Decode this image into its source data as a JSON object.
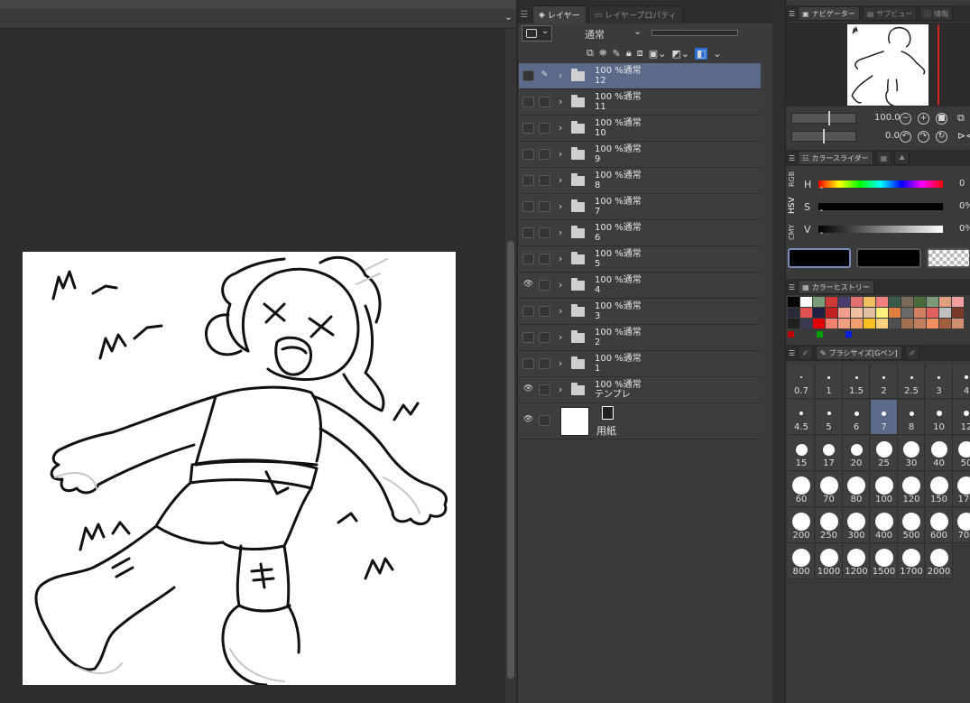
{
  "layer_panel": {
    "tabs": [
      {
        "label": "レイヤー",
        "active": true
      },
      {
        "label": "レイヤープロパティ",
        "active": false
      }
    ],
    "blend_mode": "通常",
    "layers": [
      {
        "opacity_mode": "100 %通常",
        "name": "12",
        "visible": false,
        "selected": true,
        "pen": true
      },
      {
        "opacity_mode": "100 %通常",
        "name": "11",
        "visible": false
      },
      {
        "opacity_mode": "100 %通常",
        "name": "10",
        "visible": false
      },
      {
        "opacity_mode": "100 %通常",
        "name": "9",
        "visible": false
      },
      {
        "opacity_mode": "100 %通常",
        "name": "8",
        "visible": false
      },
      {
        "opacity_mode": "100 %通常",
        "name": "7",
        "visible": false
      },
      {
        "opacity_mode": "100 %通常",
        "name": "6",
        "visible": false
      },
      {
        "opacity_mode": "100 %通常",
        "name": "5",
        "visible": false
      },
      {
        "opacity_mode": "100 %通常",
        "name": "4",
        "visible": true
      },
      {
        "opacity_mode": "100 %通常",
        "name": "3",
        "visible": false
      },
      {
        "opacity_mode": "100 %通常",
        "name": "2",
        "visible": false
      },
      {
        "opacity_mode": "100 %通常",
        "name": "1",
        "visible": false
      },
      {
        "opacity_mode": "100 %通常",
        "name": "テンプレ",
        "visible": true
      }
    ],
    "paper_layer": {
      "name": "用紙",
      "visible": true
    }
  },
  "navigator": {
    "tabs": [
      "ナビゲーター",
      "サブビュー",
      "情報"
    ],
    "zoom_value": "100.0",
    "rotate_value": "0.0"
  },
  "color_slider": {
    "tabs": [
      "カラースライダー"
    ],
    "modes": [
      "RGB",
      "HSV",
      "CMY"
    ],
    "h_label": "H",
    "h_value": "0",
    "s_label": "S",
    "s_value": "0%",
    "v_label": "V",
    "v_value": "0%"
  },
  "color_history": {
    "title": "カラーヒストリー",
    "row1": [
      "#000000",
      "#ffffff",
      "#7a9a7a",
      "#d23a3a",
      "#4a3c6e",
      "#e07070",
      "#f0c060",
      "#f08080",
      "#3a5a4a",
      "#7a6a5a",
      "#4a6a3a",
      "#7a9a7a",
      "#e0a080",
      "#f0a0a0"
    ],
    "row2": [
      "#2a2a3a",
      "#e05050",
      "#202040",
      "#c02020",
      "#f0a090",
      "#f0c0a0",
      "#e0c0a0",
      "#fff080",
      "#e08040",
      "#6a6a6a",
      "#d08060",
      "#e06060",
      "#c0c0c0",
      "#7a3a2a"
    ],
    "row3": [
      "#202020",
      "#3a3a50",
      "#e00000",
      "#f08070",
      "#f0a080",
      "#f0a070",
      "#ffc020",
      "#ffd080",
      "#505050",
      "#a07050",
      "#c08060",
      "#f09060",
      "#a06040",
      "#d09070"
    ],
    "indicators": [
      "#c00000",
      "#00a000",
      "#0020e0"
    ]
  },
  "brush_size": {
    "title": "ブラシサイズ[Gペン]",
    "sizes": [
      "0.7",
      "1",
      "1.5",
      "2",
      "2.5",
      "3",
      "4",
      "4.5",
      "5",
      "6",
      "7",
      "8",
      "10",
      "12",
      "15",
      "17",
      "20",
      "25",
      "30",
      "40",
      "50",
      "60",
      "70",
      "80",
      "100",
      "120",
      "150",
      "170",
      "200",
      "250",
      "300",
      "400",
      "500",
      "600",
      "700",
      "800",
      "1000",
      "1200",
      "1500",
      "1700",
      "2000"
    ],
    "selected": "7"
  },
  "colors": {
    "selection": "#5c6a8a",
    "panel_bg": "#3b3b3b",
    "accent_blue": "#2d6fd6"
  }
}
